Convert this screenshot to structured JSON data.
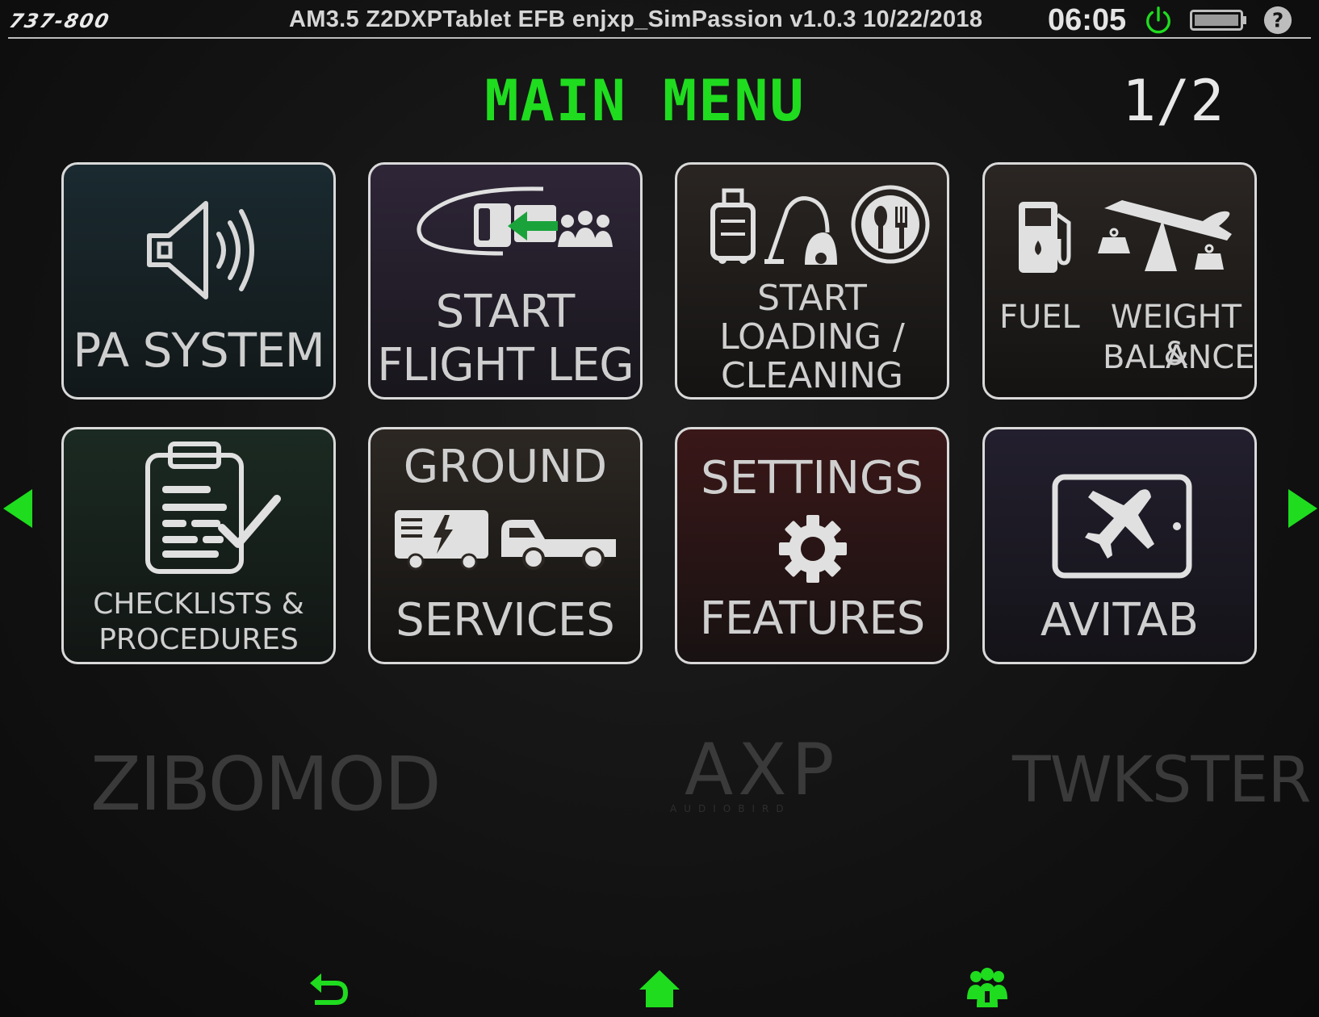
{
  "status_bar": {
    "model": "737-800",
    "info": "AM3.5  Z2DXPTablet EFB enjxp_SimPassion v1.0.3 10/22/2018",
    "clock": "06:05"
  },
  "header": {
    "title": "MAIN MENU",
    "page": "1/2"
  },
  "tiles": [
    {
      "id": "pa-system",
      "lines": [
        "PA SYSTEM"
      ]
    },
    {
      "id": "start-flight-leg",
      "lines": [
        "START",
        "FLIGHT LEG"
      ]
    },
    {
      "id": "start-loading-cleaning",
      "lines": [
        "START",
        "LOADING /",
        "CLEANING"
      ]
    },
    {
      "id": "fuel-weight-balance",
      "lines": [
        "FUEL",
        "WEIGHT &",
        "BALANCE"
      ]
    },
    {
      "id": "checklists-procedures",
      "lines": [
        "CHECKLISTS &",
        "PROCEDURES"
      ]
    },
    {
      "id": "ground-services",
      "lines": [
        "GROUND",
        "SERVICES"
      ]
    },
    {
      "id": "settings-features",
      "lines": [
        "SETTINGS",
        "FEATURES"
      ]
    },
    {
      "id": "avitab",
      "lines": [
        "AVITAB"
      ]
    }
  ],
  "logos": {
    "zibo": "ZIBOMOD",
    "axp": "AXP",
    "axp_sub": "AUDIOBIRD",
    "twk": "TWKSTER"
  },
  "icons": {
    "accent": "#1fdc1f",
    "nav": [
      "back-icon",
      "home-icon",
      "people-icon"
    ],
    "pager": [
      "prev-page-arrow",
      "next-page-arrow"
    ]
  }
}
